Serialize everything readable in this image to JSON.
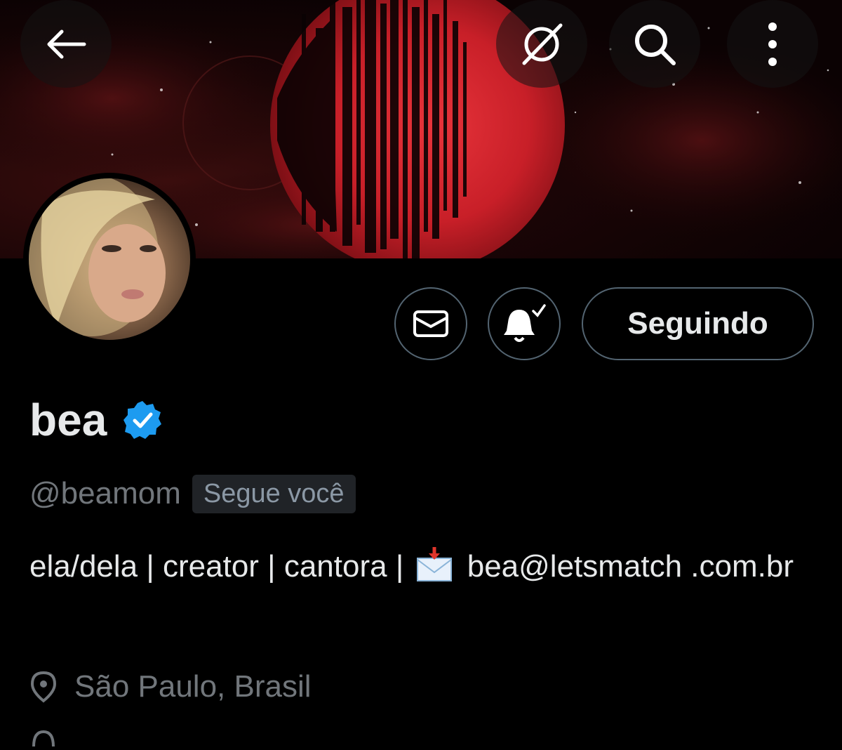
{
  "header": {
    "back_icon": "arrow-left-icon",
    "grok_icon": "grok-icon",
    "search_icon": "search-icon",
    "more_icon": "more-vertical-icon"
  },
  "banner": {
    "description_icon": "red-moon-banner"
  },
  "profile": {
    "display_name": "bea",
    "verified_icon": "verified-badge-icon",
    "verified_color": "#1d9bf0",
    "handle": "@beamom",
    "follows_you": "Segue você",
    "bio_part1": "ela/dela | creator | cantora |",
    "bio_part2": "bea@letsmatch .com.br",
    "bio_emoji": "envelope-with-arrow-emoji",
    "location": "São Paulo, Brasil"
  },
  "actions": {
    "message_icon": "envelope-icon",
    "notify_icon": "bell-check-icon",
    "follow_label": "Seguindo"
  },
  "colors": {
    "background": "#000000",
    "text_primary": "#e7e9ea",
    "text_secondary": "#71767b",
    "button_border": "#536471",
    "moon_red": "#d8282f"
  }
}
